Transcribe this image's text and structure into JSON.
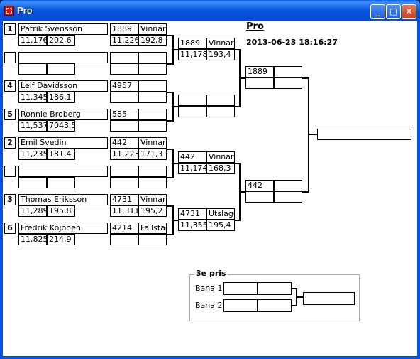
{
  "window": {
    "title": "Pro"
  },
  "header": {
    "title": "Pro",
    "datetime": "2013-06-23 18:16:27"
  },
  "round1": {
    "slot1": {
      "seed": "1",
      "name": "Patrik Svensson",
      "t1": "11,176",
      "t2": "202,6",
      "id": "1889",
      "result": "Vinnare",
      "t3": "11,226",
      "t4": "192,8"
    },
    "slot2": {
      "seed": "",
      "name": "",
      "t1": "",
      "t2": "",
      "id": "",
      "result": "",
      "t3": "",
      "t4": ""
    },
    "slot3": {
      "seed": "4",
      "name": "Leif Davidsson",
      "t1": "11,345",
      "t2": "186,1",
      "id": "4957",
      "result": "",
      "t3": "",
      "t4": ""
    },
    "slot4": {
      "seed": "5",
      "name": "Ronnie Broberg",
      "t1": "11,537",
      "t2": "7043,5",
      "id": "585",
      "result": "",
      "t3": "",
      "t4": ""
    },
    "slot5": {
      "seed": "2",
      "name": "Emil Svedin",
      "t1": "11,235",
      "t2": "181,4",
      "id": "442",
      "result": "Vinnare",
      "t3": "11,223",
      "t4": "171,3"
    },
    "slot6": {
      "seed": "",
      "name": "",
      "t1": "",
      "t2": "",
      "id": "",
      "result": "",
      "t3": "",
      "t4": ""
    },
    "slot7": {
      "seed": "3",
      "name": "Thomas Eriksson",
      "t1": "11,289",
      "t2": "195,8",
      "id": "4731",
      "result": "Vinnare",
      "t3": "11,311",
      "t4": "195,2"
    },
    "slot8": {
      "seed": "6",
      "name": "Fredrik Kojonen",
      "t1": "11,825",
      "t2": "214,9",
      "id": "4214",
      "result": "Failstage",
      "t3": "",
      "t4": ""
    }
  },
  "round2": {
    "m1": {
      "id": "1889",
      "result": "Vinnare",
      "t1": "11,178",
      "t2": "193,4"
    },
    "m2": {
      "id": "",
      "result": "",
      "t1": "",
      "t2": ""
    },
    "m3": {
      "id": "442",
      "result": "Vinnare",
      "t1": "11,174",
      "t2": "168,3"
    },
    "m4": {
      "id": "4731",
      "result": "Utslagen",
      "t1": "11,355",
      "t2": "195,4"
    }
  },
  "round3": {
    "m1": {
      "id": "1889",
      "result": "",
      "t1": "",
      "t2": ""
    },
    "m2": {
      "id": "442",
      "result": "",
      "t1": "",
      "t2": ""
    }
  },
  "final": {
    "winner": ""
  },
  "third": {
    "legend": "3e pris",
    "lane1_label": "Bana 1",
    "lane2_label": "Bana 2"
  }
}
